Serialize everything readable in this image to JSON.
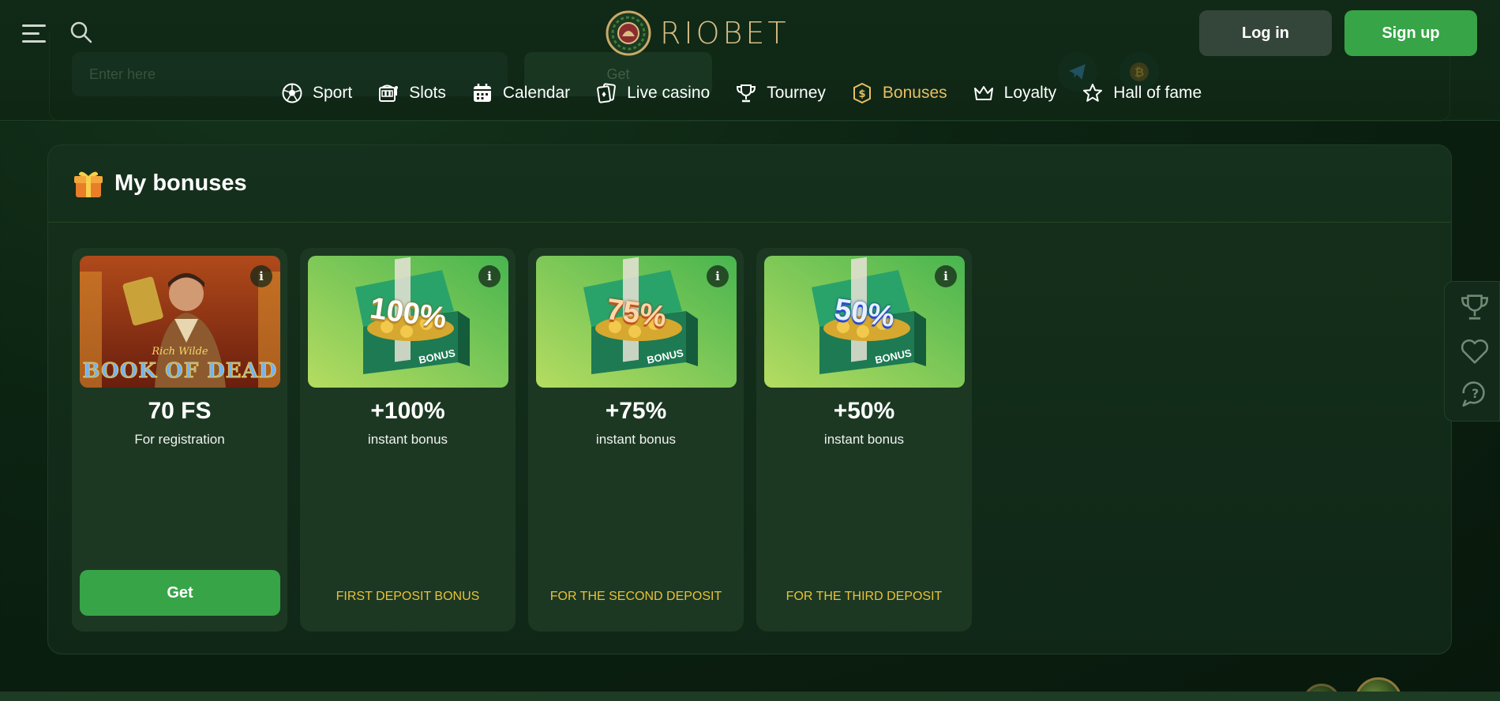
{
  "header": {
    "logo_text": "RIOBET",
    "login_label": "Log in",
    "signup_label": "Sign up",
    "bg_promo_placeholder": "Enter here",
    "bg_promo_button": "Get"
  },
  "nav": {
    "items": [
      {
        "label": "Sport",
        "icon": "soccer-ball-icon"
      },
      {
        "label": "Slots",
        "icon": "slot-machine-icon"
      },
      {
        "label": "Calendar",
        "icon": "calendar-icon"
      },
      {
        "label": "Live casino",
        "icon": "playing-cards-icon"
      },
      {
        "label": "Tourney",
        "icon": "trophy-icon"
      },
      {
        "label": "Bonuses",
        "icon": "coin-dollar-icon",
        "active": true
      },
      {
        "label": "Loyalty",
        "icon": "crown-icon"
      },
      {
        "label": "Hall of fame",
        "icon": "star-icon"
      }
    ]
  },
  "panel": {
    "title": "My bonuses",
    "cards": [
      {
        "image_title": "BOOK OF DEAD",
        "image_subtitle": "Rich Wilde",
        "amount": "70 FS",
        "subtitle": "For registration",
        "button": "Get"
      },
      {
        "badge": "100%",
        "chest_label": "BONUS",
        "amount": "+100%",
        "subtitle": "instant bonus",
        "footer": "FIRST DEPOSIT BONUS"
      },
      {
        "badge": "75%",
        "chest_label": "BONUS",
        "amount": "+75%",
        "subtitle": "instant bonus",
        "footer": "FOR THE SECOND DEPOSIT"
      },
      {
        "badge": "50%",
        "chest_label": "BONUS",
        "amount": "+50%",
        "subtitle": "instant bonus",
        "footer": "FOR THE THIRD DEPOSIT"
      }
    ],
    "info_glyph": "i"
  },
  "rail": {
    "items": [
      "trophy-icon",
      "heart-icon",
      "help-chat-icon"
    ]
  },
  "colors": {
    "accent_green": "#37a447",
    "gold": "#e7bf63",
    "footer_yellow": "#e8c238"
  }
}
